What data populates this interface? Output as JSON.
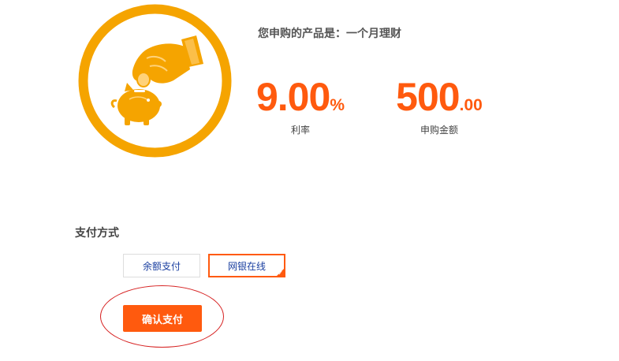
{
  "product": {
    "line": "您申购的产品是：一个月理财"
  },
  "stats": {
    "rate": {
      "value": "9.00",
      "unit": "%",
      "caption": "利率"
    },
    "amount": {
      "value": "500",
      "unit": ".00",
      "caption": "申购金额"
    }
  },
  "payment": {
    "title": "支付方式",
    "methods": [
      {
        "label": "余额支付",
        "selected": false
      },
      {
        "label": "网银在线",
        "selected": true
      }
    ],
    "check_mark": "✓",
    "confirm_label": "确认支付"
  },
  "colors": {
    "brand_orange": "#ff5a0e",
    "logo_gold": "#f5a400",
    "annotation_red": "#d62020",
    "link_blue": "#1a3fa0"
  },
  "icons": [
    "hand-dropping-coin-icon",
    "piggy-bank-icon"
  ]
}
